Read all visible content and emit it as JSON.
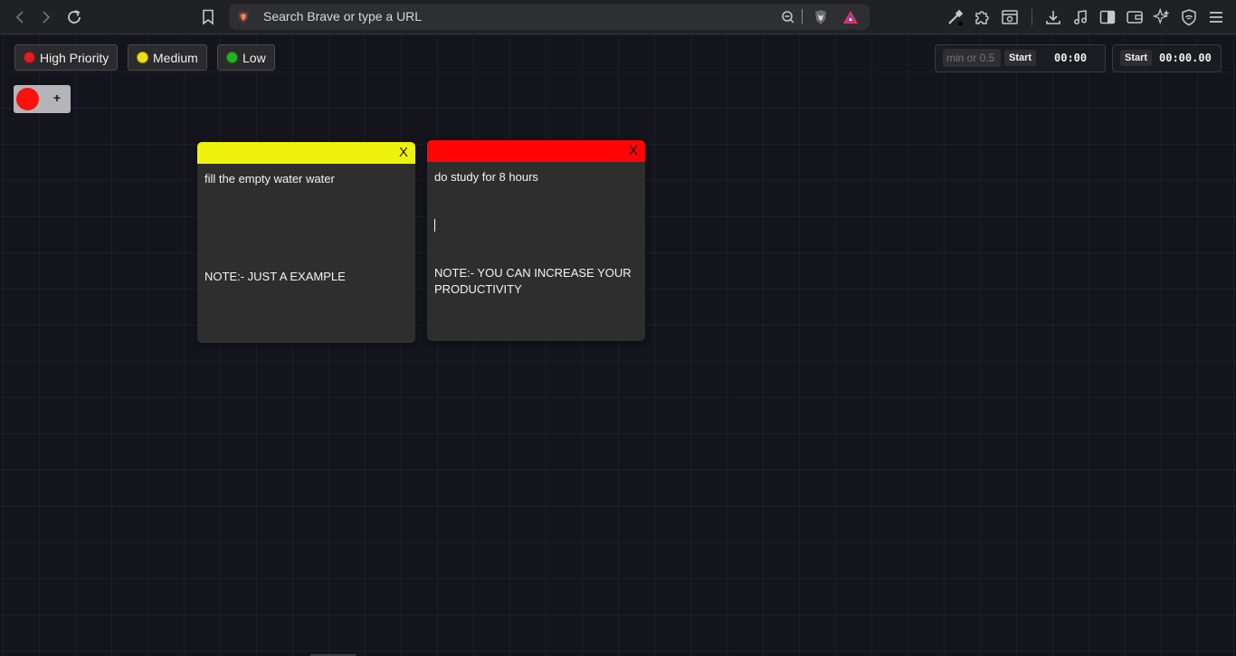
{
  "browser": {
    "address_placeholder": "Search Brave or type a URL",
    "icons": [
      "back-icon",
      "forward-icon",
      "reload-icon",
      "bookmark-icon",
      "brave-shield-icon",
      "zoom-icon",
      "brave-lion-icon",
      "rewards-triangle-icon",
      "wand-icon",
      "extensions-icon",
      "screenshot-icon",
      "download-icon",
      "music-icon",
      "sidebar-icon",
      "wallet-icon",
      "leo-ai-icon",
      "vpn-icon",
      "menu-icon"
    ]
  },
  "priority": {
    "high": {
      "label": "High Priority",
      "color": "#e01e1e"
    },
    "medium": {
      "label": "Medium",
      "color": "#f0e010"
    },
    "low": {
      "label": "Low",
      "color": "#22b422"
    }
  },
  "timer": {
    "input_placeholder": "min or 0.5",
    "start_label": "Start",
    "countdown": "00:00"
  },
  "stopwatch": {
    "start_label": "Start",
    "time": "00:00.00"
  },
  "adder": {
    "selected_color": "#ff1010",
    "plus_label": "+"
  },
  "notes": [
    {
      "color": "#eef20a",
      "close_label": "X",
      "title": "fill the empty water water",
      "body": "NOTE:- JUST A EXAMPLE"
    },
    {
      "color": "#ff0505",
      "close_label": "X",
      "title": "do study for 8 hours",
      "body": "NOTE:- YOU CAN INCREASE YOUR PRODUCTIVITY"
    }
  ]
}
